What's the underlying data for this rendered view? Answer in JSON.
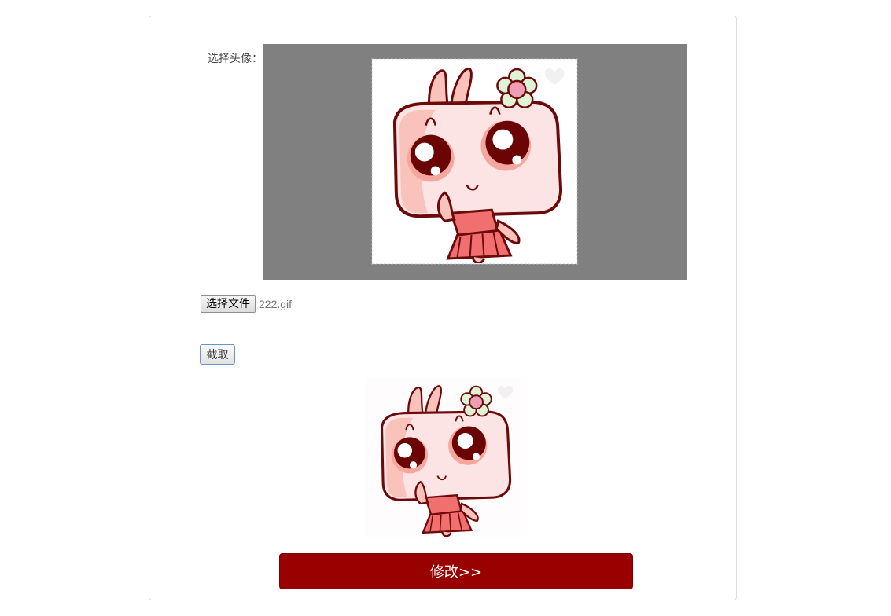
{
  "form": {
    "avatar_label": "选择头像：",
    "file_button_label": "选择文件",
    "file_name": "222.gif",
    "crop_button_label": "截取",
    "submit_button_label": "修改>>"
  },
  "icons": {
    "crop_image": "cartoon-girl-avatar",
    "preview_image": "cartoon-girl-avatar"
  },
  "colors": {
    "crop_background": "#808080",
    "submit_button": "#990000"
  }
}
